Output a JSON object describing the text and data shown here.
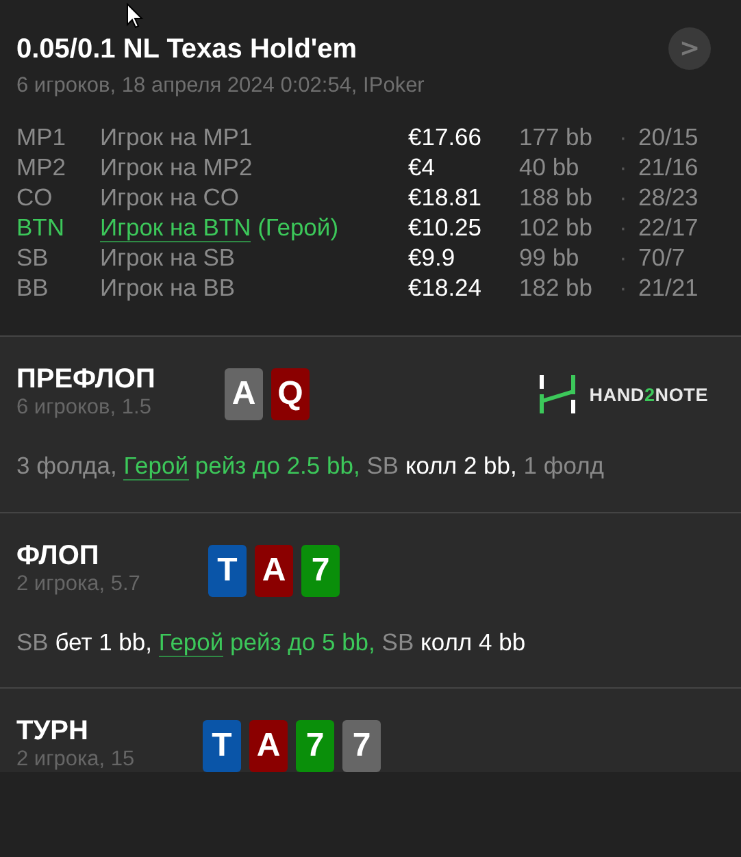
{
  "header": {
    "title": "0.05/0.1 NL Texas Hold'em",
    "subtitle": "6 игроков, 18 апреля 2024 0:02:54, IPoker",
    "next_button": ">"
  },
  "players": [
    {
      "position": "MP1",
      "name": "Игрок на MP1",
      "hero": false,
      "stack": "€17.66",
      "bb": "177 bb",
      "separator": "·",
      "stats": "20/15"
    },
    {
      "position": "MP2",
      "name": "Игрок на MP2",
      "hero": false,
      "stack": "€4",
      "bb": "40 bb",
      "separator": "·",
      "stats": "21/16"
    },
    {
      "position": "CO",
      "name": "Игрок на CO",
      "hero": false,
      "stack": "€18.81",
      "bb": "188 bb",
      "separator": "·",
      "stats": "28/23"
    },
    {
      "position": "BTN",
      "name": "Игрок на BTN",
      "hero": true,
      "hero_tag": "(Герой)",
      "stack": "€10.25",
      "bb": "102 bb",
      "separator": "·",
      "stats": "22/17"
    },
    {
      "position": "SB",
      "name": "Игрок на SB",
      "hero": false,
      "stack": "€9.9",
      "bb": "99 bb",
      "separator": "·",
      "stats": "70/7"
    },
    {
      "position": "BB",
      "name": "Игрок на BB",
      "hero": false,
      "stack": "€18.24",
      "bb": "182 bb",
      "separator": "·",
      "stats": "21/21"
    }
  ],
  "streets": [
    {
      "title": "ПРЕФЛОП",
      "info": "6 игроков, 1.5",
      "cards": [
        {
          "rank": "A",
          "color": "#666666"
        },
        {
          "rank": "Q",
          "color": "#8b0000"
        }
      ],
      "logo": {
        "before": "HAND",
        "accent": "2",
        "after": "NOTE"
      },
      "actions": [
        {
          "kind": "muted",
          "text": "3 фолда,"
        },
        {
          "kind": "hero",
          "text": "Герой"
        },
        {
          "kind": "hero_action",
          "text": "рейз до 2.5 bb,"
        },
        {
          "kind": "muted",
          "text": "SB"
        },
        {
          "kind": "action",
          "text": "колл 2 bb,"
        },
        {
          "kind": "muted",
          "text": "1 фолд"
        }
      ]
    },
    {
      "title": "ФЛОП",
      "info": "2 игрока, 5.7",
      "cards": [
        {
          "rank": "T",
          "color": "#0a55a8"
        },
        {
          "rank": "A",
          "color": "#8b0000"
        },
        {
          "rank": "7",
          "color": "#0a8f0a"
        }
      ],
      "actions": [
        {
          "kind": "muted",
          "text": "SB"
        },
        {
          "kind": "action",
          "text": "бет 1 bb,"
        },
        {
          "kind": "hero",
          "text": "Герой"
        },
        {
          "kind": "hero_action",
          "text": "рейз до 5 bb,"
        },
        {
          "kind": "muted",
          "text": "SB"
        },
        {
          "kind": "action",
          "text": "колл 4 bb"
        }
      ]
    },
    {
      "title": "ТУРН",
      "info": "2 игрока, 15",
      "cards": [
        {
          "rank": "T",
          "color": "#0a55a8"
        },
        {
          "rank": "A",
          "color": "#8b0000"
        },
        {
          "rank": "7",
          "color": "#0a8f0a"
        },
        {
          "rank": "7",
          "color": "#666666"
        }
      ]
    }
  ]
}
